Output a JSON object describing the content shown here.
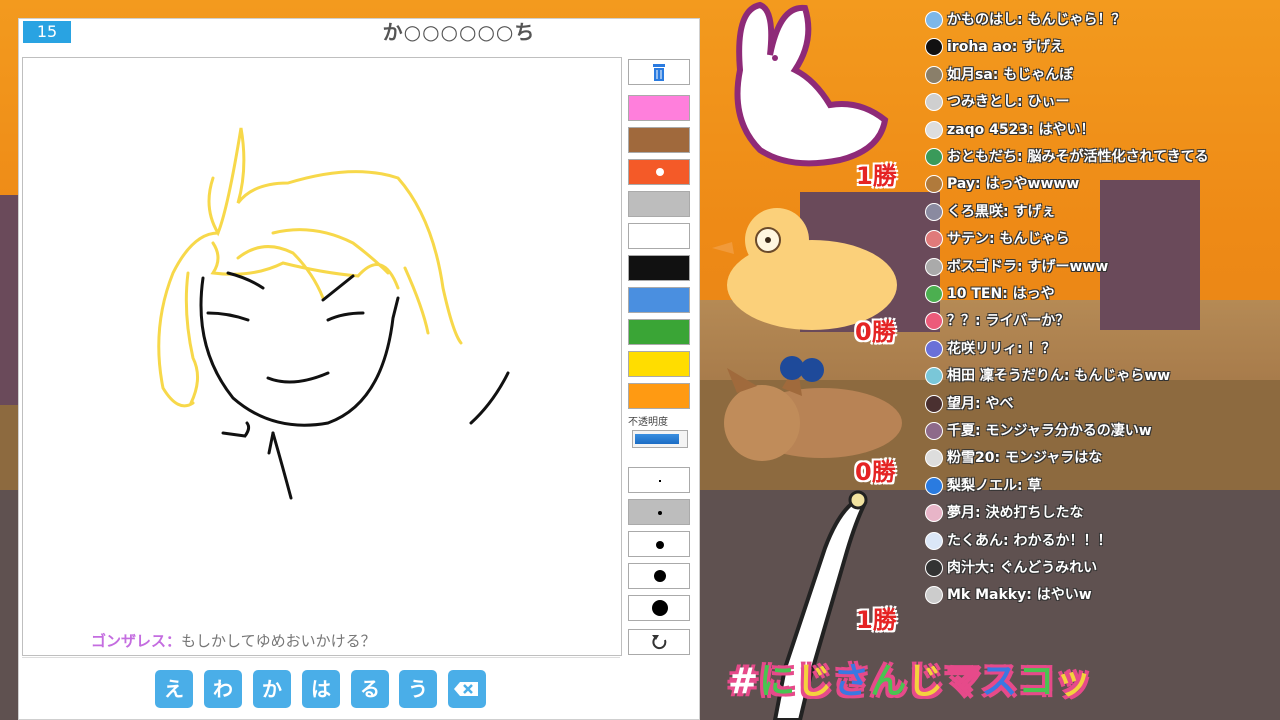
{
  "game": {
    "round_number": "15",
    "hint": "か○○○○○○ち",
    "guess": {
      "name": "ゴンザレス：",
      "text": "もしかしてゆめおいかける？"
    },
    "tools": {
      "trash_icon": "trash-icon",
      "colors": [
        "#ff7fdc",
        "#a0693c",
        "#f45a28",
        "#bdbdbd",
        "#ffffff",
        "#111111",
        "#4a8fe0",
        "#3aa536",
        "#ffdd00",
        "#ff9a12"
      ],
      "selected_color_index": 2,
      "opacity_label": "不透明度",
      "opacity_level": 0.85,
      "brush_sizes": [
        "xs",
        "s",
        "m",
        "l",
        "xl"
      ],
      "selected_brush_index": 1,
      "undo_icon": "undo-icon"
    },
    "keyboard": [
      "え",
      "わ",
      "か",
      "は",
      "る",
      "う"
    ],
    "backspace_icon": "backspace-icon"
  },
  "scores": [
    {
      "value": "1勝"
    },
    {
      "value": "0勝"
    },
    {
      "value": "0勝"
    },
    {
      "value": "1勝"
    }
  ],
  "chat": [
    {
      "user": "かものはし",
      "msg": "もんじゃら！？",
      "color": "#7db7e8"
    },
    {
      "user": "iroha ao",
      "msg": "すげえ",
      "color": "#111111"
    },
    {
      "user": "如月sa",
      "msg": "もじゃんぼ",
      "color": "#8a7f6a"
    },
    {
      "user": "つみきとし",
      "msg": "ひぃー",
      "color": "#cfcfcf"
    },
    {
      "user": "zaqo 4523",
      "msg": "はやい！",
      "color": "#dddddd"
    },
    {
      "user": "おともだち",
      "msg": "脳みそが活性化されてきてる",
      "color": "#3a9a5a"
    },
    {
      "user": "Pay",
      "msg": "はっやwwww",
      "color": "#b07a3c"
    },
    {
      "user": "くろ黒咲",
      "msg": "すげぇ",
      "color": "#8a8aa0"
    },
    {
      "user": "サテン",
      "msg": "もんじゃら",
      "color": "#e07a7a"
    },
    {
      "user": "ボスゴドラ",
      "msg": "すげーwww",
      "color": "#aaaaaa"
    },
    {
      "user": "10 TEN",
      "msg": "はっや",
      "color": "#4caf50"
    },
    {
      "user": "？？",
      "msg": "ライバーか？",
      "color": "#ec5a7a"
    },
    {
      "user": "花咲リリィ",
      "msg": "！？",
      "color": "#6a70d8"
    },
    {
      "user": "相田 凜そうだりん",
      "msg": "もんじゃらww",
      "color": "#7ac7d8"
    },
    {
      "user": "望月",
      "msg": "やべ",
      "color": "#4a3030"
    },
    {
      "user": "千夏",
      "msg": "モンジャラ分かるの凄いw",
      "color": "#8e6a8a"
    },
    {
      "user": "粉雪20",
      "msg": "モンジャラはな",
      "color": "#ddd"
    },
    {
      "user": "梨梨ノエル",
      "msg": "草",
      "color": "#2a7be0"
    },
    {
      "user": "夢月",
      "msg": "決め打ちしたな",
      "color": "#e8b5c8"
    },
    {
      "user": "たくあん",
      "msg": "わかるか！！！",
      "color": "#dbe7f7"
    },
    {
      "user": "肉汁大",
      "msg": "ぐんどうみれい",
      "color": "#333"
    },
    {
      "user": "Mk Makky",
      "msg": "はやいw",
      "color": "#ccc"
    }
  ],
  "hashtag": {
    "parts": [
      "#",
      "に",
      "じ",
      "さ",
      "ん",
      "じ",
      "マ",
      "ス",
      "コ",
      "ッ"
    ]
  }
}
